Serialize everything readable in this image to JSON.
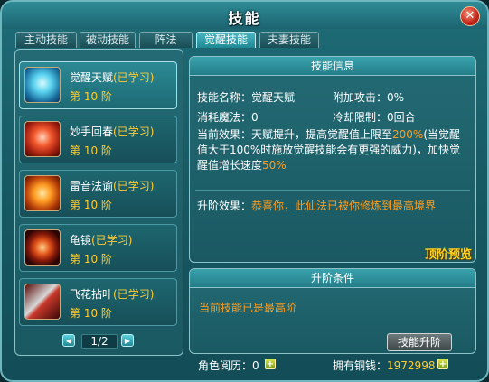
{
  "window": {
    "title": "技能",
    "close_symbol": "✕"
  },
  "tabs": [
    {
      "label": "主动技能",
      "active": false
    },
    {
      "label": "被动技能",
      "active": false
    },
    {
      "label": "阵法",
      "active": false
    },
    {
      "label": "觉醒技能",
      "active": true
    },
    {
      "label": "夫妻技能",
      "active": false
    }
  ],
  "skills": [
    {
      "name": "觉醒天赋",
      "status": "(已学习)",
      "level": "第 10 阶",
      "icon": "blue-aura-figure-icon",
      "selected": true
    },
    {
      "name": "妙手回春",
      "status": "(已学习)",
      "level": "第 10 阶",
      "icon": "red-aura-figure-icon",
      "selected": false
    },
    {
      "name": "雷音法谕",
      "status": "(已学习)",
      "level": "第 10 阶",
      "icon": "flame-figure-icon",
      "selected": false
    },
    {
      "name": "龟镜",
      "status": "(已学习)",
      "level": "第 10 阶",
      "icon": "shield-icon",
      "selected": false
    },
    {
      "name": "飞花拈叶",
      "status": "(已学习)",
      "level": "第 10 阶",
      "icon": "blade-icon",
      "selected": false
    }
  ],
  "pagination": {
    "current": "1/2"
  },
  "info": {
    "header": "技能信息",
    "name_label": "技能名称：",
    "name_value": "觉醒天赋",
    "bonus_label": "附加攻击：",
    "bonus_value": "0%",
    "mana_label": "消耗魔法：",
    "mana_value": "0",
    "cooldown_label": "冷却限制：",
    "cooldown_value": "0回合",
    "effect_label": "当前效果：",
    "effect_text_1": "天赋提升，提高觉醒值上限至",
    "effect_highlight_1": "200%",
    "effect_text_2": "(当觉醒值大于100%时施放觉醒技能会有更强的威力)，加快觉醒值增长速度",
    "effect_highlight_2": "50%",
    "upgrade_label": "升阶效果：",
    "upgrade_text": "恭喜你，此仙法已被你修炼到最高境界",
    "preview_link": "顶阶预览"
  },
  "condition": {
    "header": "升阶条件",
    "text": "当前技能已是最高阶",
    "upgrade_button": "技能升阶"
  },
  "footer": {
    "experience_label": "角色阅历：",
    "experience_value": "0",
    "money_label": "拥有铜钱：",
    "money_value": "1972998",
    "plus_symbol": "+"
  },
  "colors": {
    "accent_gold": "#ffcc33",
    "accent_orange": "#ff9d1e",
    "panel": "#1a5962"
  }
}
